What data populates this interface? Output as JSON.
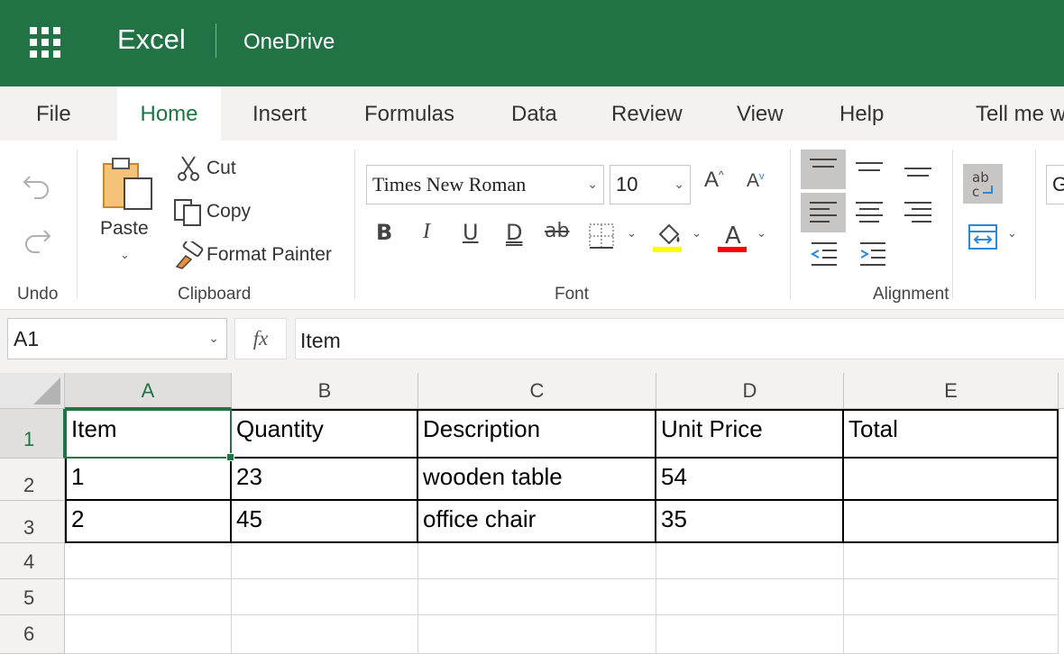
{
  "titlebar": {
    "app_name": "Excel",
    "location": "OneDrive"
  },
  "tabs": [
    {
      "label": "File"
    },
    {
      "label": "Home"
    },
    {
      "label": "Insert"
    },
    {
      "label": "Formulas"
    },
    {
      "label": "Data"
    },
    {
      "label": "Review"
    },
    {
      "label": "View"
    },
    {
      "label": "Help"
    },
    {
      "label": "Tell me w"
    }
  ],
  "ribbon": {
    "undo_group": "Undo",
    "clipboard": {
      "paste": "Paste",
      "cut": "Cut",
      "copy": "Copy",
      "format_painter": "Format Painter",
      "group": "Clipboard"
    },
    "font": {
      "name": "Times New Roman",
      "size": "10",
      "group": "Font",
      "highlight_color": "#ffff00",
      "font_color": "#ff0000"
    },
    "alignment": {
      "group": "Alignment"
    },
    "cut_off_next": "G"
  },
  "formula_bar": {
    "name_box": "A1",
    "fx": "fx",
    "value": "Item"
  },
  "sheet": {
    "columns": [
      "A",
      "B",
      "C",
      "D",
      "E"
    ],
    "rows": [
      "1",
      "2",
      "3",
      "4",
      "5",
      "6"
    ],
    "cells": [
      [
        "Item",
        "Quantity",
        "Description",
        "Unit Price",
        "Total"
      ],
      [
        "1",
        "23",
        "wooden table",
        "54",
        ""
      ],
      [
        "2",
        "45",
        "office chair",
        "35",
        ""
      ],
      [
        "",
        "",
        "",
        "",
        ""
      ],
      [
        "",
        "",
        "",
        "",
        ""
      ],
      [
        "",
        "",
        "",
        "",
        ""
      ]
    ]
  },
  "colors": {
    "brand": "#217346"
  }
}
